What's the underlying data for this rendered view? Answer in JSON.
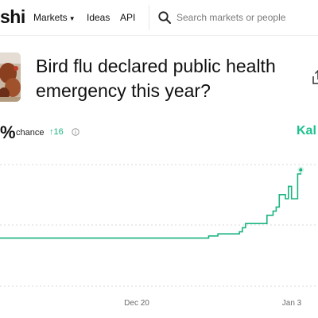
{
  "header": {
    "logo_text": "shi",
    "nav": [
      {
        "label": "Markets",
        "has_dropdown": true
      },
      {
        "label": "Ideas"
      },
      {
        "label": "API"
      }
    ],
    "search": {
      "placeholder": "Search markets or people",
      "icon": "search-icon"
    }
  },
  "market": {
    "title": "Bird flu declared public health emergency this year?",
    "thumbnail": "chickens-photo",
    "share_icon": "share-icon"
  },
  "stats": {
    "percent_suffix": "%",
    "chance_label": "chance",
    "change": "↑16",
    "info_icon": "info-icon",
    "brand_label": "Kal"
  },
  "colors": {
    "accent": "#1cc08e",
    "line": "#1bb383",
    "grid": "#dadada"
  },
  "chart_data": {
    "type": "line",
    "x_tick_labels": [
      "Dec 20",
      "Jan 3"
    ],
    "series": [
      {
        "values": [
          {
            "x": 0,
            "y": 1
          },
          {
            "x": 68,
            "y": 1
          },
          {
            "x": 68,
            "y": 2
          },
          {
            "x": 71,
            "y": 2
          },
          {
            "x": 71,
            "y": 3
          },
          {
            "x": 78,
            "y": 3
          },
          {
            "x": 78,
            "y": 4
          },
          {
            "x": 79,
            "y": 4
          },
          {
            "x": 79,
            "y": 6
          },
          {
            "x": 80,
            "y": 6
          },
          {
            "x": 80,
            "y": 8
          },
          {
            "x": 87,
            "y": 8
          },
          {
            "x": 87,
            "y": 12
          },
          {
            "x": 89,
            "y": 12
          },
          {
            "x": 89,
            "y": 14
          },
          {
            "x": 90,
            "y": 14
          },
          {
            "x": 90,
            "y": 16
          },
          {
            "x": 91,
            "y": 16
          },
          {
            "x": 91,
            "y": 22
          },
          {
            "x": 93,
            "y": 22
          },
          {
            "x": 93,
            "y": 20
          },
          {
            "x": 94,
            "y": 20
          },
          {
            "x": 94,
            "y": 26
          },
          {
            "x": 95,
            "y": 26
          },
          {
            "x": 95,
            "y": 20
          },
          {
            "x": 97,
            "y": 20
          },
          {
            "x": 97,
            "y": 32
          },
          {
            "x": 98,
            "y": 32
          },
          {
            "x": 98,
            "y": 34
          }
        ]
      }
    ],
    "current_value": 34,
    "grid": true
  }
}
